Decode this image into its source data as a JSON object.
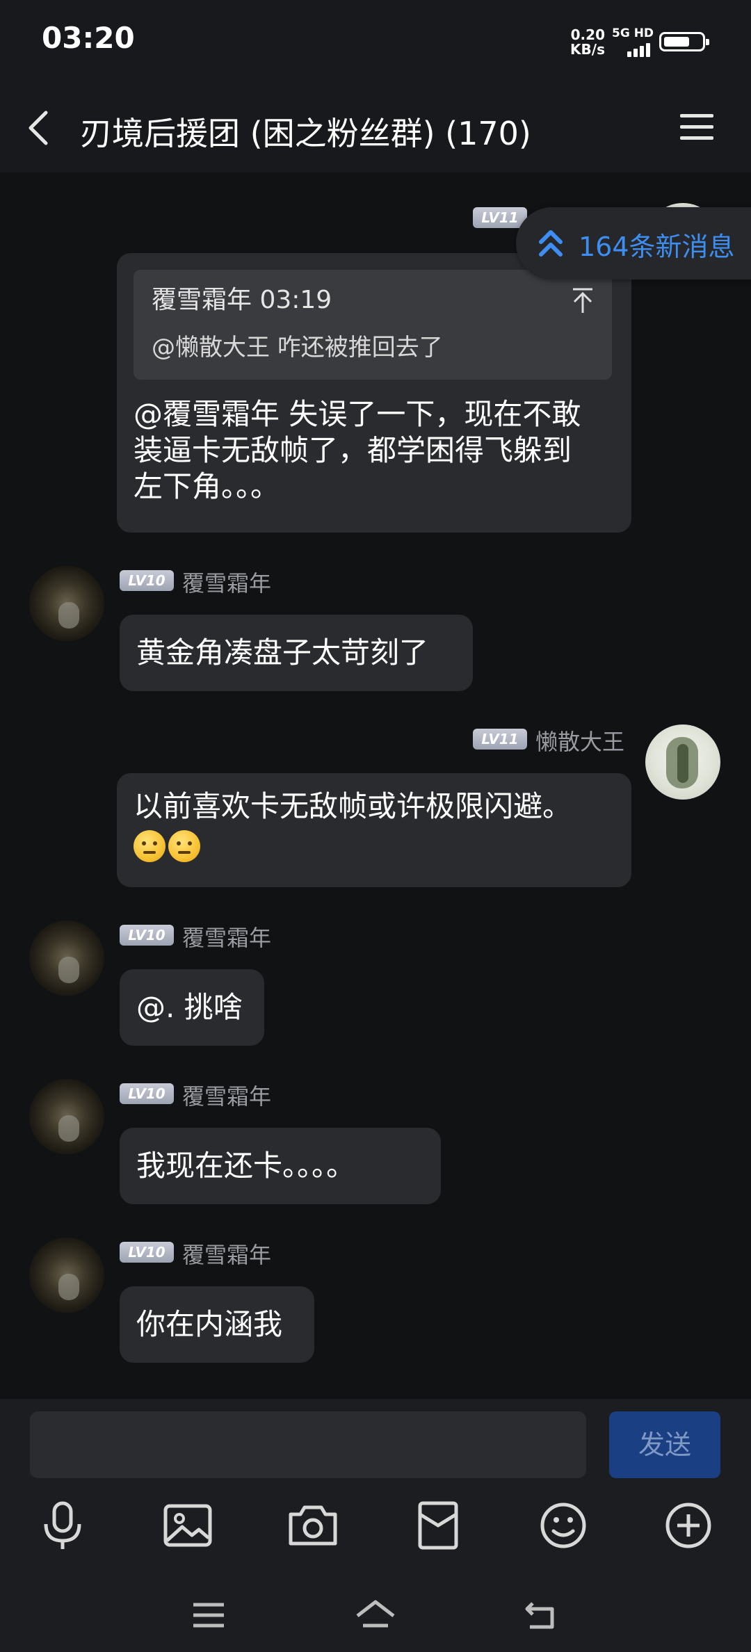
{
  "status_bar": {
    "time": "03:20",
    "net_speed": "0.20",
    "net_unit": "KB/s",
    "signal": "5G HD",
    "battery_level_pct": 70
  },
  "header": {
    "title": "刃境后援团 (困之粉丝群) (170)",
    "icons": [
      "back-chevron-icon",
      "menu-icon"
    ]
  },
  "new_messages": {
    "label": "164条新消息",
    "icon": "double-chevron-up-icon",
    "color": "#3d8ef0"
  },
  "messages": [
    {
      "side": "right",
      "level": "LV11",
      "quote": {
        "sender": "覆雪霜年",
        "time": "03:19",
        "text": "@懒散大王  咋还被推回去了",
        "icon": "jump-to-top-icon"
      },
      "lines": [
        "@覆雪霜年 失误了一下，现在不敢",
        "装逼卡无敌帧了，都学困得飞躲到",
        "左下角。。。"
      ]
    },
    {
      "side": "left",
      "level": "LV10",
      "nickname": "覆雪霜年",
      "text": "黄金角凑盘子太苛刻了"
    },
    {
      "side": "right",
      "level": "LV11",
      "nickname": "懒散大王",
      "text": "以前喜欢卡无敌帧或许极限闪避。",
      "emojis": [
        "thinking-face-emoji",
        "worried-face-emoji"
      ]
    },
    {
      "side": "left",
      "level": "LV10",
      "nickname": "覆雪霜年",
      "text": "@. 挑啥"
    },
    {
      "side": "left",
      "level": "LV10",
      "nickname": "覆雪霜年",
      "text": "我现在还卡。。。。"
    },
    {
      "side": "left",
      "level": "LV10",
      "nickname": "覆雪霜年",
      "text": "你在内涵我"
    }
  ],
  "composer": {
    "input_value": "",
    "send_label": "发送",
    "send_color": "#1a3f82"
  },
  "toolbar": [
    "microphone-icon",
    "image-icon",
    "camera-icon",
    "red-packet-icon",
    "emoji-icon",
    "plus-icon"
  ],
  "system_nav": [
    "menu-nav-icon",
    "home-nav-icon",
    "back-nav-icon"
  ]
}
